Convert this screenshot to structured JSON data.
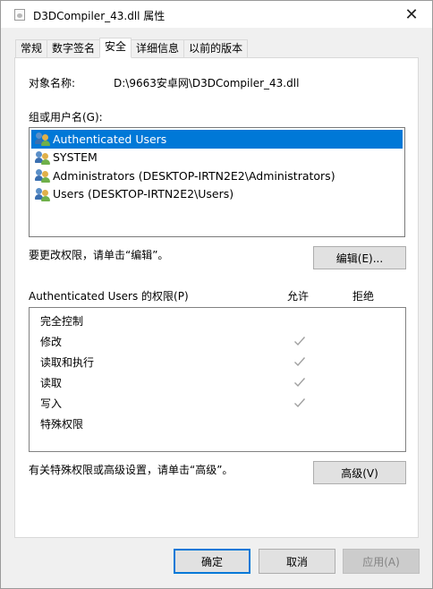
{
  "window": {
    "title": "D3DCompiler_43.dll 属性",
    "close_glyph": "✕"
  },
  "tabs": [
    {
      "label": "常规"
    },
    {
      "label": "数字签名"
    },
    {
      "label": "安全"
    },
    {
      "label": "详细信息"
    },
    {
      "label": "以前的版本"
    }
  ],
  "active_tab": "安全",
  "security": {
    "object_name_label": "对象名称:",
    "object_name_value": "D:\\9663安卓网\\D3DCompiler_43.dll",
    "groups_label": "组或用户名(G):",
    "users": [
      {
        "name": "Authenticated Users",
        "icon": "users-group-icon",
        "selected": true
      },
      {
        "name": "SYSTEM",
        "icon": "users-group-icon",
        "selected": false
      },
      {
        "name": "Administrators (DESKTOP-IRTN2E2\\Administrators)",
        "icon": "users-group-icon",
        "selected": false
      },
      {
        "name": "Users (DESKTOP-IRTN2E2\\Users)",
        "icon": "users-group-icon",
        "selected": false
      }
    ],
    "edit_hint": "要更改权限，请单击“编辑”。",
    "edit_button": "编辑(E)...",
    "permissions_label": "Authenticated Users 的权限(P)",
    "allow_header": "允许",
    "deny_header": "拒绝",
    "permissions": [
      {
        "name": "完全控制",
        "allow": false,
        "deny": false
      },
      {
        "name": "修改",
        "allow": true,
        "deny": false
      },
      {
        "name": "读取和执行",
        "allow": true,
        "deny": false
      },
      {
        "name": "读取",
        "allow": true,
        "deny": false
      },
      {
        "name": "写入",
        "allow": true,
        "deny": false
      },
      {
        "name": "特殊权限",
        "allow": false,
        "deny": false
      }
    ],
    "advanced_hint": "有关特殊权限或高级设置，请单击“高级”。",
    "advanced_button": "高级(V)"
  },
  "footer": {
    "ok": "确定",
    "cancel": "取消",
    "apply": "应用(A)"
  },
  "colors": {
    "selection": "#0078d7",
    "check": "#a0a0a0"
  }
}
